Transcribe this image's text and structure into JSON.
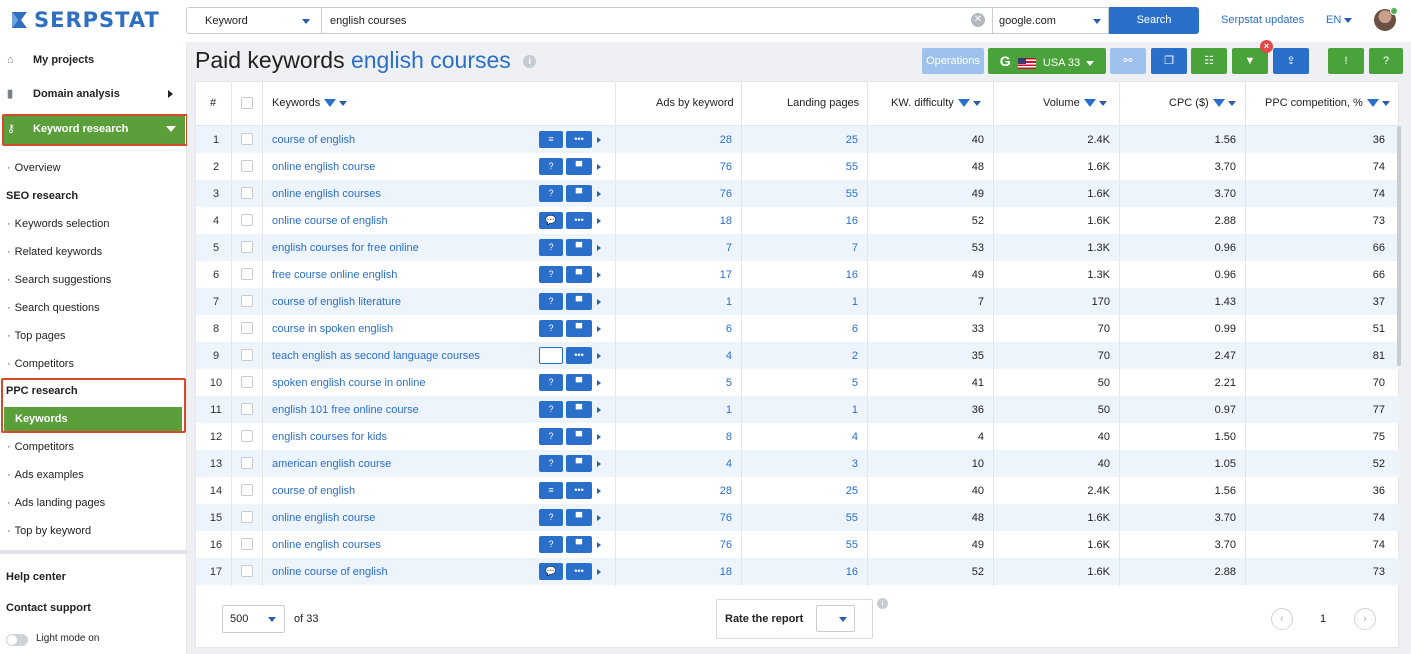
{
  "brand": {
    "name": "SERPSTAT"
  },
  "search": {
    "type_label": "Keyword",
    "query": "english courses",
    "database": "google.com",
    "button": "Search"
  },
  "header": {
    "updates": "Serpstat updates",
    "lang": "EN"
  },
  "sidebar": {
    "my_projects": "My projects",
    "domain_analysis": "Domain analysis",
    "keyword_research": "Keyword research",
    "overview": "Overview",
    "seo_research": "SEO research",
    "seo_items": [
      "Keywords selection",
      "Related keywords",
      "Search suggestions",
      "Search questions",
      "Top pages",
      "Competitors"
    ],
    "ppc_research": "PPC research",
    "ppc_active": "Keywords",
    "ppc_items": [
      "Competitors",
      "Ads examples",
      "Ads landing pages",
      "Top by keyword"
    ],
    "help_center": "Help center",
    "contact_support": "Contact support",
    "light_mode": "Light mode on"
  },
  "page": {
    "title_prefix": "Paid keywords",
    "title_query": "english courses",
    "info": "i"
  },
  "toolbar": {
    "operations": "Operations",
    "country": "USA 33",
    "g_letter": "G",
    "close": "×"
  },
  "table": {
    "headers": {
      "num": "#",
      "keywords": "Keywords",
      "ads": "Ads by keyword",
      "landing": "Landing pages",
      "difficulty": "KW. difficulty",
      "volume": "Volume",
      "cpc": "CPC ($)",
      "ppc": "PPC competition, %"
    },
    "rows": [
      {
        "n": "1",
        "kw": "course of english",
        "ads": "28",
        "landing": "25",
        "kd": "40",
        "vol": "2.4K",
        "cpc": "1.56",
        "ppc": "36",
        "i1": "list"
      },
      {
        "n": "2",
        "kw": "online english course",
        "ads": "76",
        "landing": "55",
        "kd": "48",
        "vol": "1.6K",
        "cpc": "3.70",
        "ppc": "74",
        "i1": "q"
      },
      {
        "n": "3",
        "kw": "online english courses",
        "ads": "76",
        "landing": "55",
        "kd": "49",
        "vol": "1.6K",
        "cpc": "3.70",
        "ppc": "74",
        "i1": "q"
      },
      {
        "n": "4",
        "kw": "online course of english",
        "ads": "18",
        "landing": "16",
        "kd": "52",
        "vol": "1.6K",
        "cpc": "2.88",
        "ppc": "73",
        "i1": "chat"
      },
      {
        "n": "5",
        "kw": "english courses for free online",
        "ads": "7",
        "landing": "7",
        "kd": "53",
        "vol": "1.3K",
        "cpc": "0.96",
        "ppc": "66",
        "i1": "q"
      },
      {
        "n": "6",
        "kw": "free course online english",
        "ads": "17",
        "landing": "16",
        "kd": "49",
        "vol": "1.3K",
        "cpc": "0.96",
        "ppc": "66",
        "i1": "q"
      },
      {
        "n": "7",
        "kw": "course of english literature",
        "ads": "1",
        "landing": "1",
        "kd": "7",
        "vol": "170",
        "cpc": "1.43",
        "ppc": "37",
        "i1": "q"
      },
      {
        "n": "8",
        "kw": "course in spoken english",
        "ads": "6",
        "landing": "6",
        "kd": "33",
        "vol": "70",
        "cpc": "0.99",
        "ppc": "51",
        "i1": "q"
      },
      {
        "n": "9",
        "kw": "teach english as second language courses",
        "ads": "4",
        "landing": "2",
        "kd": "35",
        "vol": "70",
        "cpc": "2.47",
        "ppc": "81",
        "i1": "blank"
      },
      {
        "n": "10",
        "kw": "spoken english course in online",
        "ads": "5",
        "landing": "5",
        "kd": "41",
        "vol": "50",
        "cpc": "2.21",
        "ppc": "70",
        "i1": "q"
      },
      {
        "n": "11",
        "kw": "english 101 free online course",
        "ads": "1",
        "landing": "1",
        "kd": "36",
        "vol": "50",
        "cpc": "0.97",
        "ppc": "77",
        "i1": "q"
      },
      {
        "n": "12",
        "kw": "english courses for kids",
        "ads": "8",
        "landing": "4",
        "kd": "4",
        "vol": "40",
        "cpc": "1.50",
        "ppc": "75",
        "i1": "q"
      },
      {
        "n": "13",
        "kw": "american english course",
        "ads": "4",
        "landing": "3",
        "kd": "10",
        "vol": "40",
        "cpc": "1.05",
        "ppc": "52",
        "i1": "q"
      },
      {
        "n": "14",
        "kw": "course of english",
        "ads": "28",
        "landing": "25",
        "kd": "40",
        "vol": "2.4K",
        "cpc": "1.56",
        "ppc": "36",
        "i1": "list"
      },
      {
        "n": "15",
        "kw": "online english course",
        "ads": "76",
        "landing": "55",
        "kd": "48",
        "vol": "1.6K",
        "cpc": "3.70",
        "ppc": "74",
        "i1": "q"
      },
      {
        "n": "16",
        "kw": "online english courses",
        "ads": "76",
        "landing": "55",
        "kd": "49",
        "vol": "1.6K",
        "cpc": "3.70",
        "ppc": "74",
        "i1": "q"
      },
      {
        "n": "17",
        "kw": "online course of english",
        "ads": "18",
        "landing": "16",
        "kd": "52",
        "vol": "1.6K",
        "cpc": "2.88",
        "ppc": "73",
        "i1": "chat"
      }
    ]
  },
  "footer": {
    "per_page": "500",
    "of_total": "of 33",
    "rate": "Rate the report",
    "page": "1"
  },
  "colors": {
    "accent": "#2a6fc9",
    "green": "#4aa33a",
    "highlight": "#d6492a"
  }
}
